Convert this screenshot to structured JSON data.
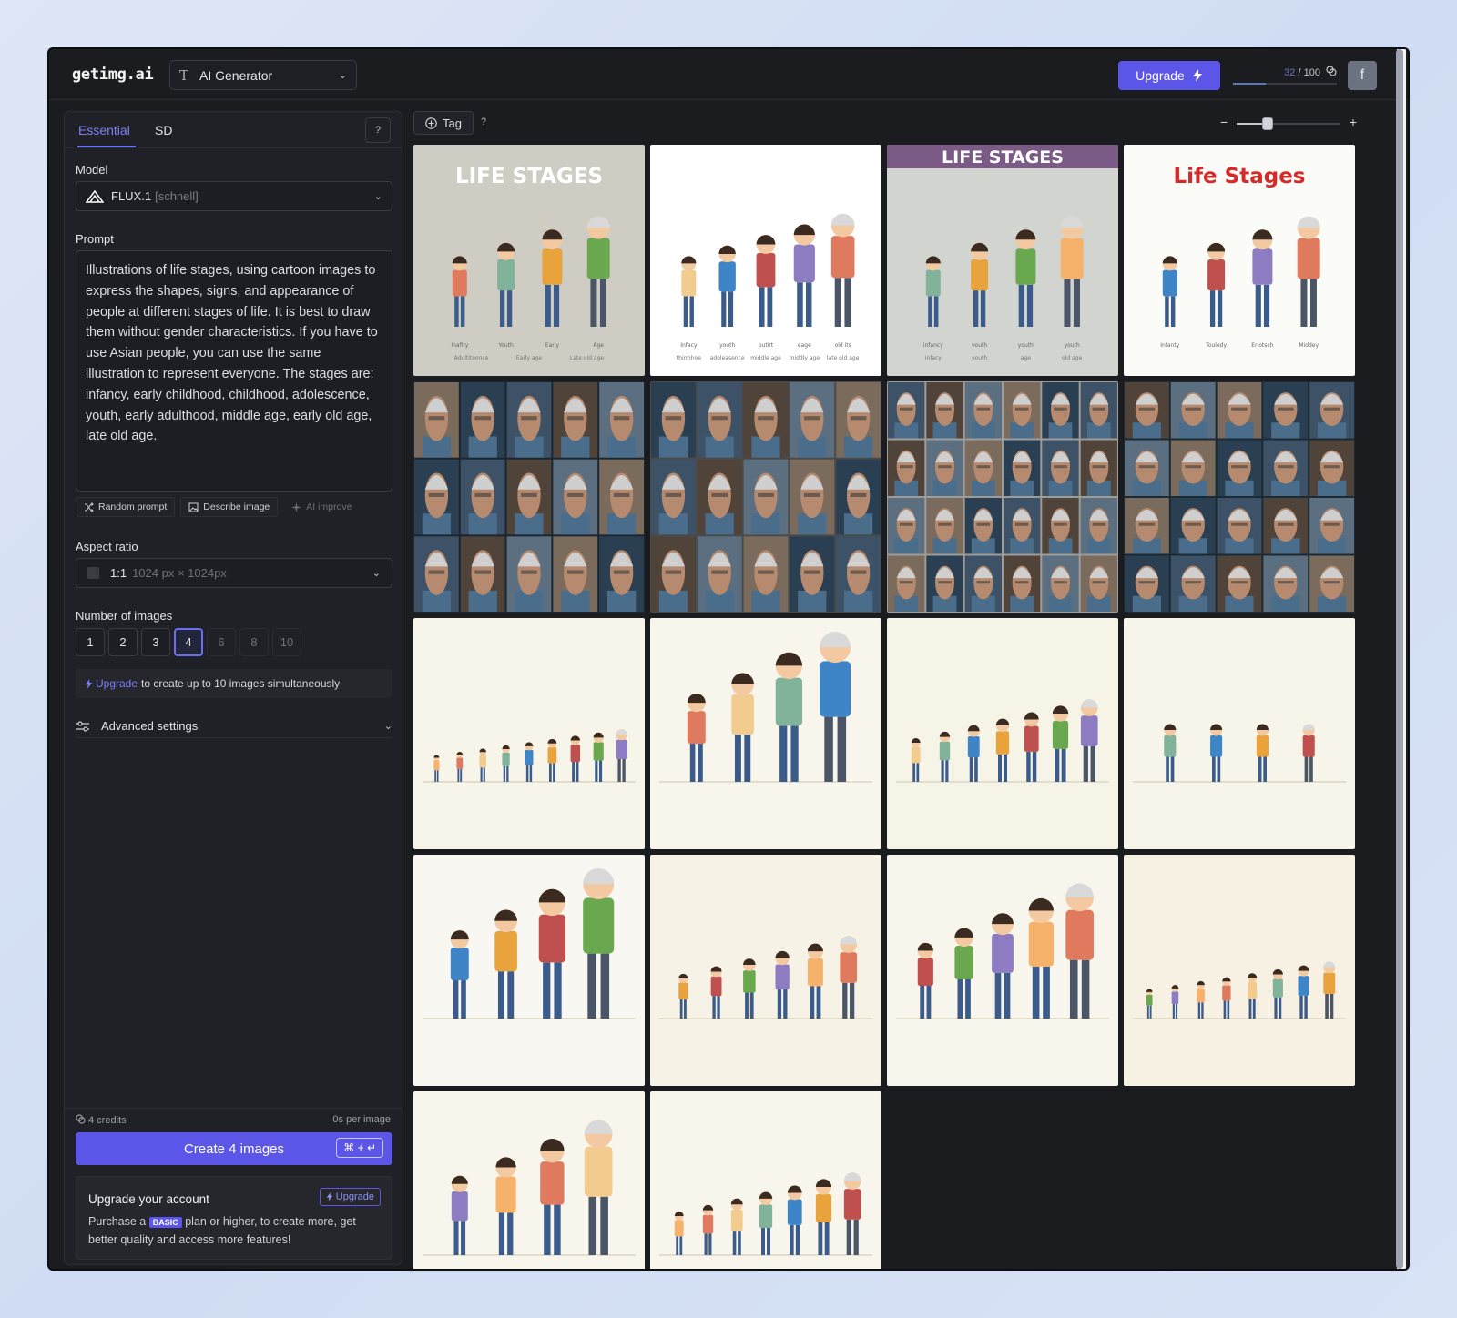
{
  "header": {
    "logo": "getimg.ai",
    "mode": "AI Generator",
    "upgrade_label": "Upgrade",
    "credits_used": "32",
    "credits_total": "/ 100",
    "credits_fraction": 0.32,
    "avatar_initial": "f"
  },
  "sidebar": {
    "tabs": [
      "Essential",
      "SD"
    ],
    "model_label": "Model",
    "model_name": "FLUX.1",
    "model_variant": "[schnell]",
    "prompt_label": "Prompt",
    "prompt_text": "Illustrations of life stages, using cartoon images to express the shapes, signs, and appearance of people at different stages of life. It is best to draw them without gender characteristics. If you have to use Asian people, you can use the same illustration to represent everyone. The stages are: infancy, early childhood, childhood, adolescence, youth, early adulthood, middle age, early old age, late old age.",
    "prompt_actions": [
      "Random prompt",
      "Describe image",
      "AI improve"
    ],
    "aspect_label": "Aspect ratio",
    "aspect_value": "1:1",
    "aspect_detail": "1024 px × 1024px",
    "num_label": "Number of images",
    "num_options": [
      "1",
      "2",
      "3",
      "4",
      "6",
      "8",
      "10"
    ],
    "num_selected": "4",
    "upsell_link": "Upgrade",
    "upsell_text": "to create up to 10 images simultaneously",
    "advanced_label": "Advanced settings",
    "credits_cost": "4 credits",
    "time_per_image": "0s per image",
    "create_label": "Create 4 images",
    "create_shortcut": "⌘ + ↵",
    "card_title": "Upgrade your account",
    "card_button": "Upgrade",
    "card_text_1": "Purchase a",
    "card_badge": "BASIC",
    "card_text_2": "plan or higher, to create more, get better quality and access more features!"
  },
  "gallery": {
    "tag_label": "Tag",
    "zoom_level": 0.3,
    "tiles": [
      {
        "kind": "poster",
        "bg": "#cfcdc3",
        "title": "LIFE STAGES",
        "titleColor": "#ffffff",
        "band": "",
        "fig": 4,
        "labels": [
          "Inafity",
          "Youth",
          "Early",
          "Age"
        ],
        "labels2": [
          "Adultitoonce",
          "Early age",
          "Late old age"
        ]
      },
      {
        "kind": "poster",
        "bg": "#ffffff",
        "title": "",
        "titleColor": "#eeeeee",
        "band": "",
        "fig": 5,
        "labels": [
          "Infacy",
          "youth",
          "outirt",
          "eage",
          "old its"
        ],
        "labels2": [
          "thirmhoe",
          "adoleasence",
          "middle age",
          "middly age",
          "late old age"
        ]
      },
      {
        "kind": "poster",
        "bg": "#d2d4d0",
        "title": "LIFE STAGES",
        "titleColor": "#ffffff",
        "band": "#7b5b86",
        "fig": 4,
        "labels": [
          "infancy",
          "youth",
          "youth",
          "youth"
        ],
        "labels2": [
          "infacy",
          "youth",
          "age",
          "old age"
        ]
      },
      {
        "kind": "poster",
        "bg": "#fbfbf8",
        "title": "Life Stages",
        "titleColor": "#d62a2a",
        "band": "",
        "fig": 4,
        "labels": [
          "Infanty",
          "Touledy",
          "Eriotsch",
          "Middey"
        ],
        "labels2": []
      },
      {
        "kind": "faces",
        "bg": "#1a2630",
        "cols": 5,
        "rows": 3
      },
      {
        "kind": "faces",
        "bg": "#4a4a48",
        "cols": 5,
        "rows": 3
      },
      {
        "kind": "faces",
        "bg": "#9e9c98",
        "cols": 6,
        "rows": 4
      },
      {
        "kind": "faces",
        "bg": "#1b2a33",
        "cols": 5,
        "rows": 4
      },
      {
        "kind": "people",
        "bg": "#f7f4ea",
        "count": 9,
        "scale": 0.35,
        "grow": true
      },
      {
        "kind": "people",
        "bg": "#f8f6ec",
        "count": 4,
        "scale": 1.0,
        "grow": true
      },
      {
        "kind": "people",
        "bg": "#f6f3e7",
        "count": 7,
        "scale": 0.55,
        "grow": true
      },
      {
        "kind": "people",
        "bg": "#f7f4ea",
        "count": 4,
        "scale": 0.55,
        "grow": false
      },
      {
        "kind": "people",
        "bg": "#f9f7f1",
        "count": 4,
        "scale": 1.0,
        "grow": true
      },
      {
        "kind": "people",
        "bg": "#f6f2e6",
        "count": 6,
        "scale": 0.55,
        "grow": true
      },
      {
        "kind": "people",
        "bg": "#f8f5ec",
        "count": 5,
        "scale": 0.9,
        "grow": true
      },
      {
        "kind": "people",
        "bg": "#f7f1e3",
        "count": 8,
        "scale": 0.38,
        "grow": true
      },
      {
        "kind": "people",
        "bg": "#f8f5ec",
        "count": 4,
        "scale": 0.9,
        "grow": true
      },
      {
        "kind": "people",
        "bg": "#f8f5ec",
        "count": 7,
        "scale": 0.55,
        "grow": true
      }
    ]
  },
  "colors": {
    "accent": "#5b55e8",
    "accent_text": "#7c7ff6"
  },
  "icons": [
    "flux-logo-icon",
    "chevron-down-icon",
    "help-icon",
    "lightning-icon",
    "coins-icon",
    "shuffle-icon",
    "image-icon",
    "sparkle-icon",
    "sliders-icon",
    "plus-circle-icon"
  ]
}
